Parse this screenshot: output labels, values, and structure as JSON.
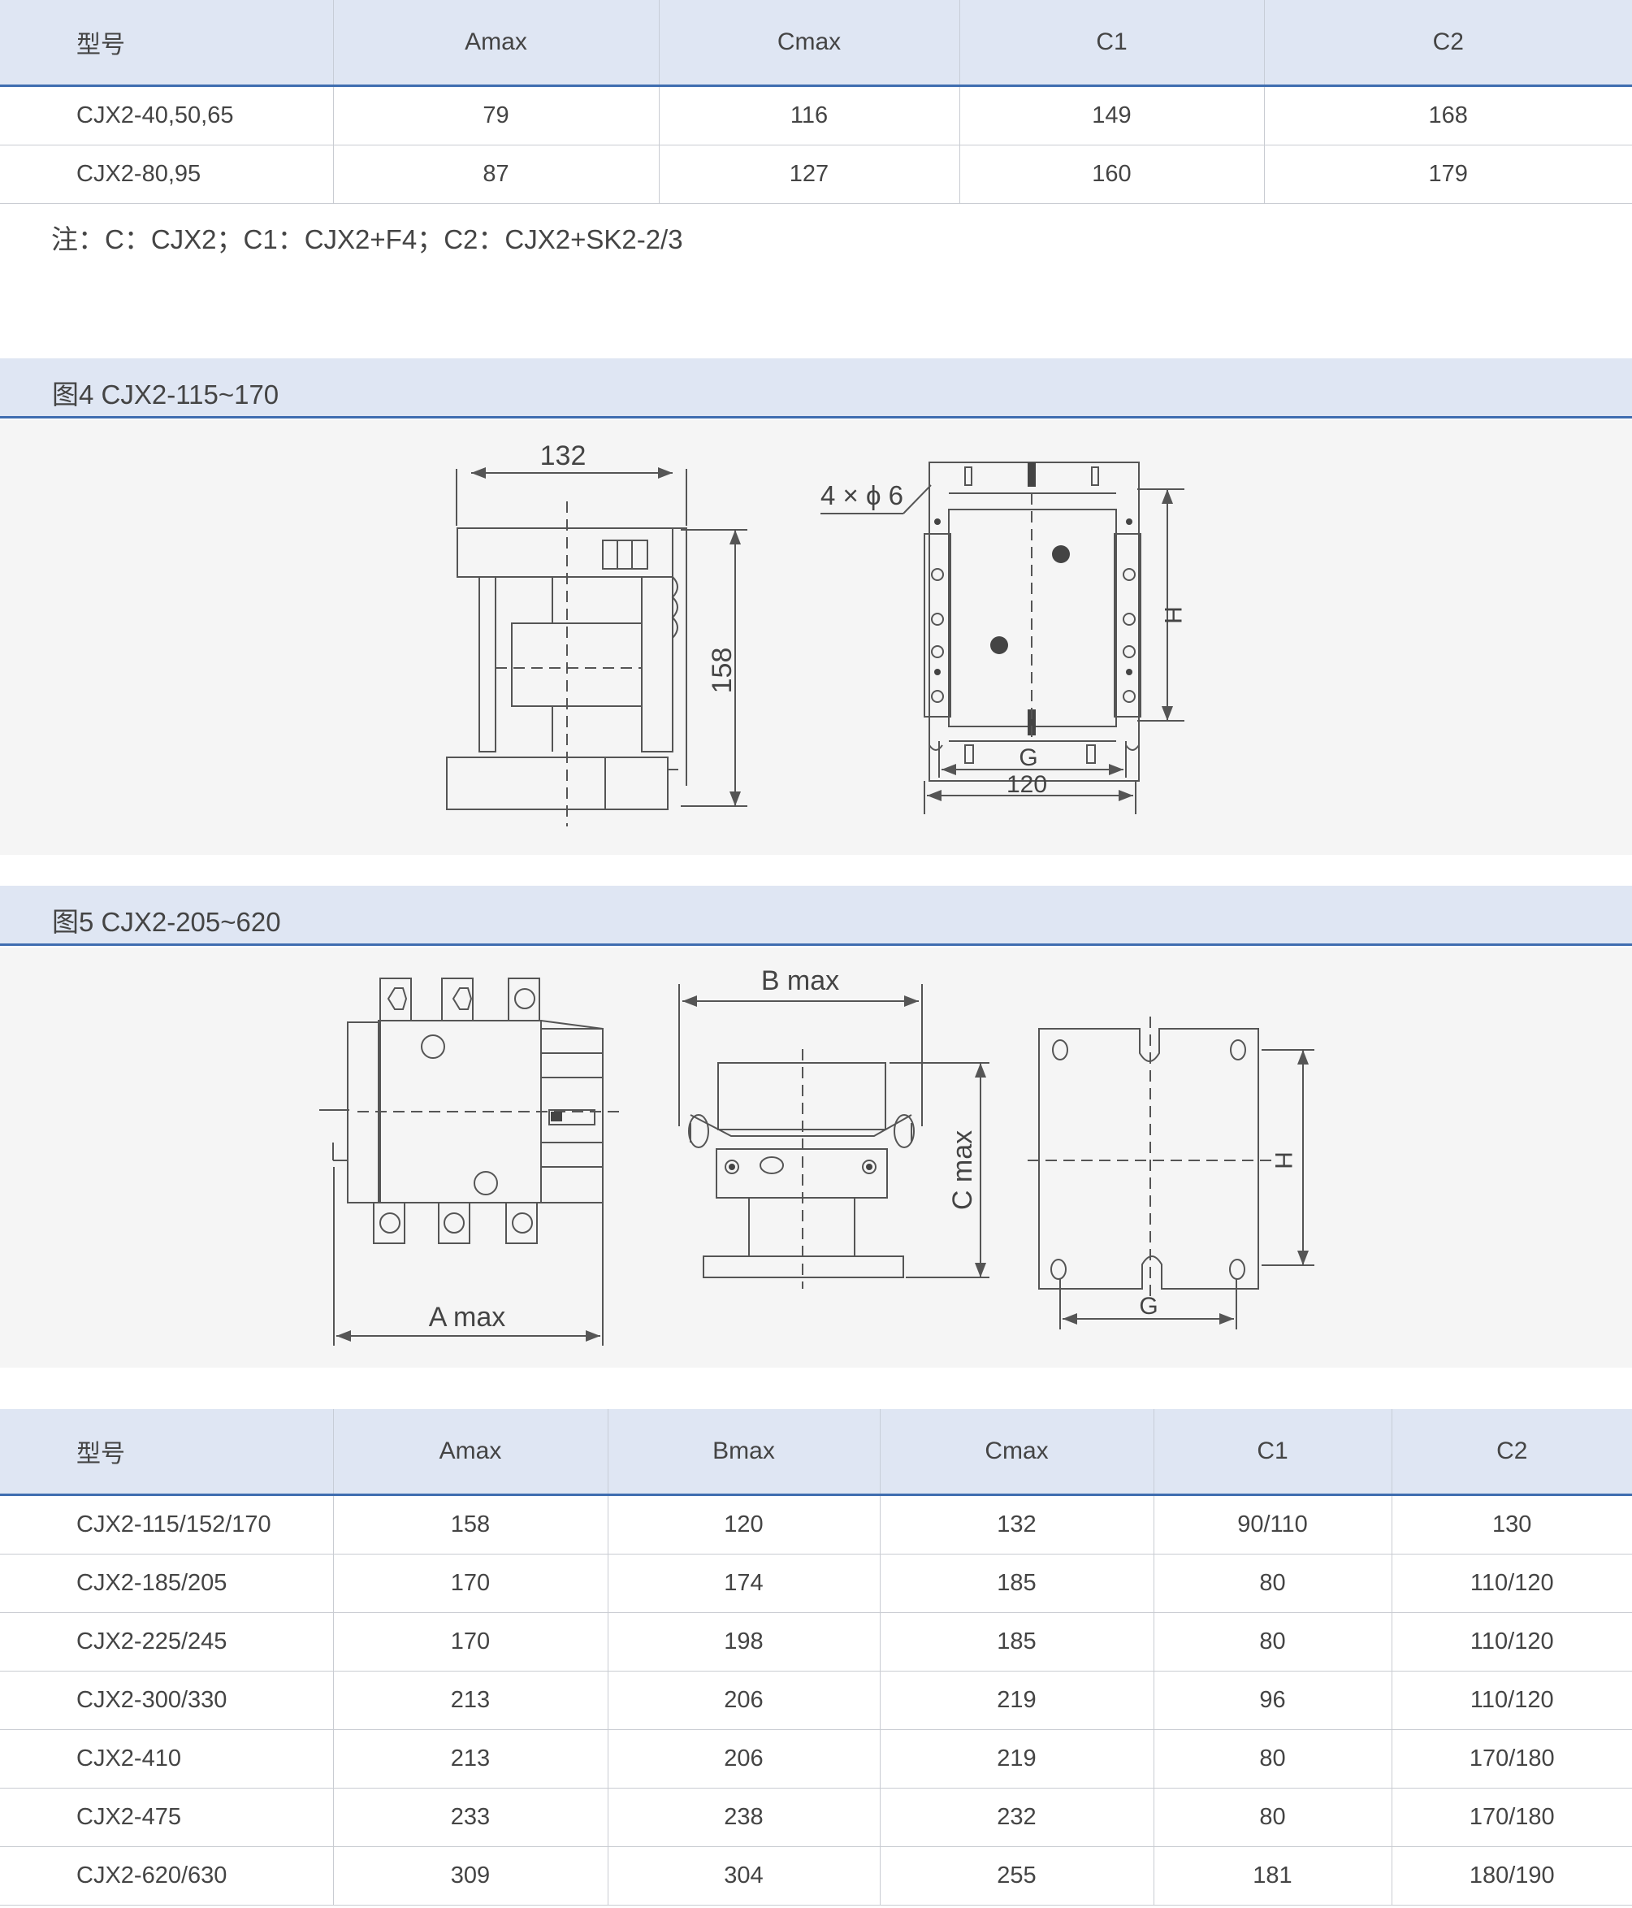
{
  "table1": {
    "headers": [
      "型号",
      "Amax",
      "Cmax",
      "C1",
      "C2"
    ],
    "rows": [
      [
        "CJX2-40,50,65",
        "79",
        "116",
        "149",
        "168"
      ],
      [
        "CJX2-80,95",
        "87",
        "127",
        "160",
        "179"
      ]
    ]
  },
  "note": "注：C：CJX2；C1：CJX2+F4；C2：CJX2+SK2-2/3",
  "figure4": {
    "title": "图4  CJX2-115~170",
    "dim_width": "132",
    "dim_height": "158",
    "hole_label": "4 × ϕ 6",
    "dim_h": "H",
    "dim_g": "G",
    "dim_base": "120"
  },
  "figure5": {
    "title": "图5  CJX2-205~620",
    "dim_a": "A max",
    "dim_b": "B max",
    "dim_c": "C max",
    "dim_h": "H",
    "dim_g": "G"
  },
  "table2": {
    "headers": [
      "型号",
      "Amax",
      "Bmax",
      "Cmax",
      "C1",
      "C2"
    ],
    "rows": [
      [
        "CJX2-115/152/170",
        "158",
        "120",
        "132",
        "90/110",
        "130"
      ],
      [
        "CJX2-185/205",
        "170",
        "174",
        "185",
        "80",
        "110/120"
      ],
      [
        "CJX2-225/245",
        "170",
        "198",
        "185",
        "80",
        "110/120"
      ],
      [
        "CJX2-300/330",
        "213",
        "206",
        "219",
        "96",
        "110/120"
      ],
      [
        "CJX2-410",
        "213",
        "206",
        "219",
        "80",
        "170/180"
      ],
      [
        "CJX2-475",
        "233",
        "238",
        "232",
        "80",
        "170/180"
      ],
      [
        "CJX2-620/630",
        "309",
        "304",
        "255",
        "181",
        "180/190"
      ]
    ]
  }
}
